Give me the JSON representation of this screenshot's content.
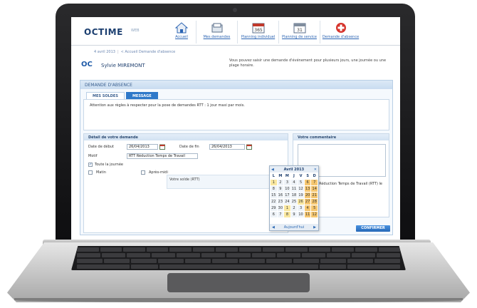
{
  "app": {
    "logo": "OCTIME",
    "logo_suffix": "WEB"
  },
  "nav": [
    {
      "label": "Accueil",
      "icon": "home-icon"
    },
    {
      "label": "Mes demandes",
      "icon": "inbox-icon"
    },
    {
      "label": "Planning individuel",
      "icon": "calendar-icon"
    },
    {
      "label": "Planning de service",
      "icon": "calendar-grid-icon"
    },
    {
      "label": "Demande d'absence",
      "icon": "medical-cross-icon"
    }
  ],
  "breadcrumb": {
    "date": "4 avril 2013",
    "home": "< Accueil",
    "current": "Demande d'absence"
  },
  "user": {
    "badge": "OC",
    "name": "Sylvie MIREMONT"
  },
  "intro_text": "Vous pouvez saisir une demande d'événement pour plusieurs jours, une journée ou une plage horaire.",
  "panel": {
    "title": "DEMANDE D'ABSENCE",
    "tabs": [
      "MES SOLDES",
      "MESSAGE"
    ],
    "message": "Attention aux règles à respecter pour la pose de demandes RTT : 1 jour maxi par mois."
  },
  "form": {
    "title": "Détail de votre demande",
    "start_label": "Date de début",
    "start_value": "26/04/2013",
    "end_label": "Date de fin",
    "end_value": "26/04/2013",
    "motif_label": "Motif",
    "motif_value": "RTT  Réduction Temps de Travail",
    "full_day_label": "Toute la journée",
    "full_day_checked": "✓",
    "morning_label": "Matin",
    "afternoon_label": "Après-midi",
    "solde_label": "Votre solde (RTT)"
  },
  "comment": {
    "title": "Votre commentaire",
    "summary": "Evénement Réduction Temps de Travail (RTT) le 26/04/2013"
  },
  "calendar": {
    "month": "Avril 2013",
    "dow": [
      "L",
      "M",
      "M",
      "J",
      "V",
      "S",
      "D"
    ],
    "weeks": [
      [
        "1",
        "2",
        "3",
        "4",
        "5",
        "6",
        "7"
      ],
      [
        "8",
        "9",
        "10",
        "11",
        "12",
        "13",
        "14"
      ],
      [
        "15",
        "16",
        "17",
        "18",
        "19",
        "20",
        "21"
      ],
      [
        "22",
        "23",
        "24",
        "25",
        "26",
        "27",
        "28"
      ],
      [
        "29",
        "30",
        "1",
        "2",
        "3",
        "4",
        "5"
      ],
      [
        "6",
        "7",
        "8",
        "9",
        "10",
        "11",
        "12"
      ]
    ],
    "today": "Aujourd'hui"
  },
  "confirm_label": "CONFIRMER",
  "colors": {
    "accent": "#2f79c9",
    "weekend": "#f6c770",
    "brand": "#1c3f70"
  }
}
